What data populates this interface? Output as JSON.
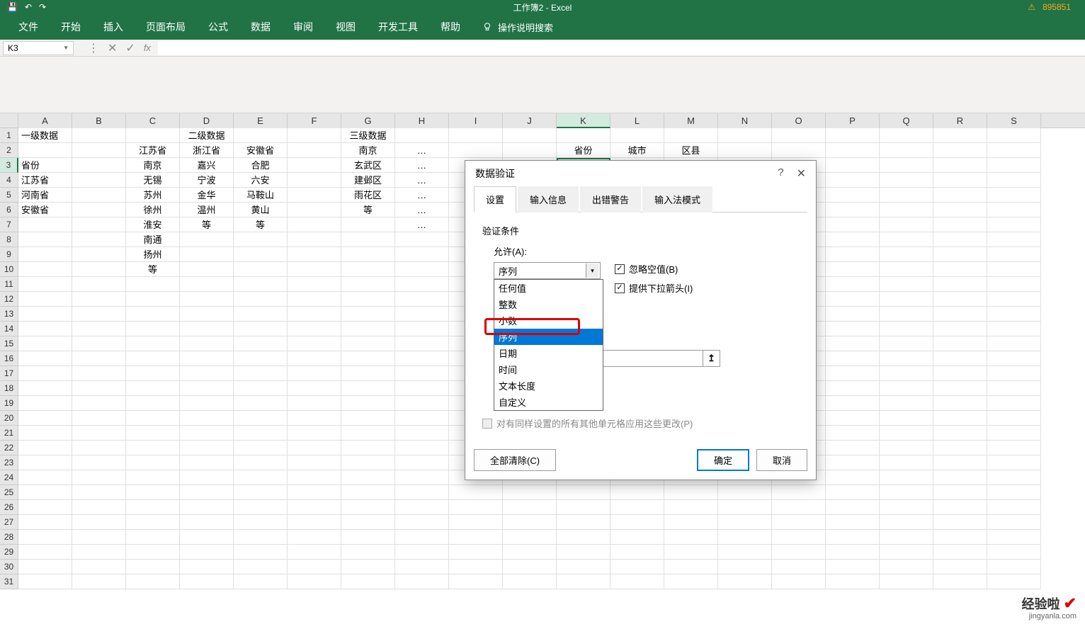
{
  "title_bar": {
    "doc_title": "工作簿2 - Excel",
    "right_code": "895851"
  },
  "ribbon": {
    "tabs": [
      "文件",
      "开始",
      "插入",
      "页面布局",
      "公式",
      "数据",
      "审阅",
      "视图",
      "开发工具",
      "帮助"
    ],
    "help_text": "操作说明搜索"
  },
  "formula_bar": {
    "name_box": "K3"
  },
  "columns": [
    "A",
    "B",
    "C",
    "D",
    "E",
    "F",
    "G",
    "H",
    "I",
    "J",
    "K",
    "L",
    "M",
    "N",
    "O",
    "P",
    "Q",
    "R",
    "S"
  ],
  "active_col_index": 10,
  "row_count": 31,
  "active_row_index": 2,
  "cells": {
    "r1": {
      "A": "一级数据",
      "D": "二级数据",
      "G": "三级数据"
    },
    "r2": {
      "C": "江苏省",
      "D": "浙江省",
      "E": "安徽省",
      "G": "南京",
      "H": "…",
      "K": "省份",
      "L": "城市",
      "M": "区县"
    },
    "r3": {
      "A": "省份",
      "C": "南京",
      "D": "嘉兴",
      "E": "合肥",
      "G": "玄武区",
      "H": "…"
    },
    "r4": {
      "A": "江苏省",
      "C": "无锡",
      "D": "宁波",
      "E": "六安",
      "G": "建邺区",
      "H": "…"
    },
    "r5": {
      "A": "河南省",
      "C": "苏州",
      "D": "金华",
      "E": "马鞍山",
      "G": "雨花区",
      "H": "…"
    },
    "r6": {
      "A": "安徽省",
      "C": "徐州",
      "D": "温州",
      "E": "黄山",
      "G": "等",
      "H": "…"
    },
    "r7": {
      "C": "淮安",
      "D": "等",
      "E": "等",
      "H": "…"
    },
    "r8": {
      "C": "南通"
    },
    "r9": {
      "C": "扬州"
    },
    "r10": {
      "C": "等"
    }
  },
  "dialog": {
    "title": "数据验证",
    "help_icon": "?",
    "close_icon": "✕",
    "tabs": [
      "设置",
      "输入信息",
      "出错警告",
      "输入法模式"
    ],
    "active_tab": 0,
    "section_label": "验证条件",
    "allow_label": "允许(A):",
    "allow_value": "序列",
    "dropdown_options": [
      "任何值",
      "整数",
      "小数",
      "序列",
      "日期",
      "时间",
      "文本长度",
      "自定义"
    ],
    "dropdown_selected_index": 3,
    "check_ignore": "忽略空值(B)",
    "check_dropdown": "提供下拉箭头(I)",
    "apply_label": "对有同样设置的所有其他单元格应用这些更改(P)",
    "clear_btn": "全部清除(C)",
    "ok_btn": "确定",
    "cancel_btn": "取消"
  },
  "watermark": {
    "text": "经验啦",
    "url": "jingyanla.com"
  }
}
